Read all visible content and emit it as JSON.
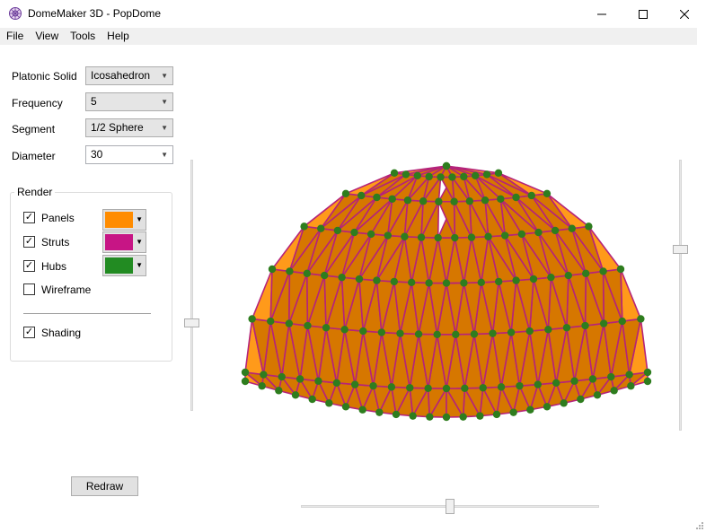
{
  "window": {
    "title": "DomeMaker 3D - PopDome",
    "controls": {
      "minimize": "—",
      "maximize": "☐",
      "close": "✕"
    }
  },
  "menu": {
    "items": [
      {
        "label": "File"
      },
      {
        "label": "View"
      },
      {
        "label": "Tools"
      },
      {
        "label": "Help"
      }
    ]
  },
  "settings": {
    "platonic_solid": {
      "label": "Platonic Solid",
      "value": "Icosahedron"
    },
    "frequency": {
      "label": "Frequency",
      "value": "5"
    },
    "segment": {
      "label": "Segment",
      "value": "1/2 Sphere"
    },
    "diameter": {
      "label": "Diameter",
      "value": "30"
    }
  },
  "render": {
    "title": "Render",
    "panels": {
      "label": "Panels",
      "checked": true,
      "color": "#ff8c00"
    },
    "struts": {
      "label": "Struts",
      "checked": true,
      "color": "#c71585"
    },
    "hubs": {
      "label": "Hubs",
      "checked": true,
      "color": "#228b22"
    },
    "wireframe": {
      "label": "Wireframe",
      "checked": false
    },
    "shading": {
      "label": "Shading",
      "checked": true
    }
  },
  "actions": {
    "redraw_label": "Redraw"
  },
  "colors": {
    "panel_fill": "#d67700",
    "panel_light": "#ff9a1a",
    "strut": "#b5237a",
    "hub": "#2e7d1e",
    "menubar_bg": "#f0f0f0"
  }
}
